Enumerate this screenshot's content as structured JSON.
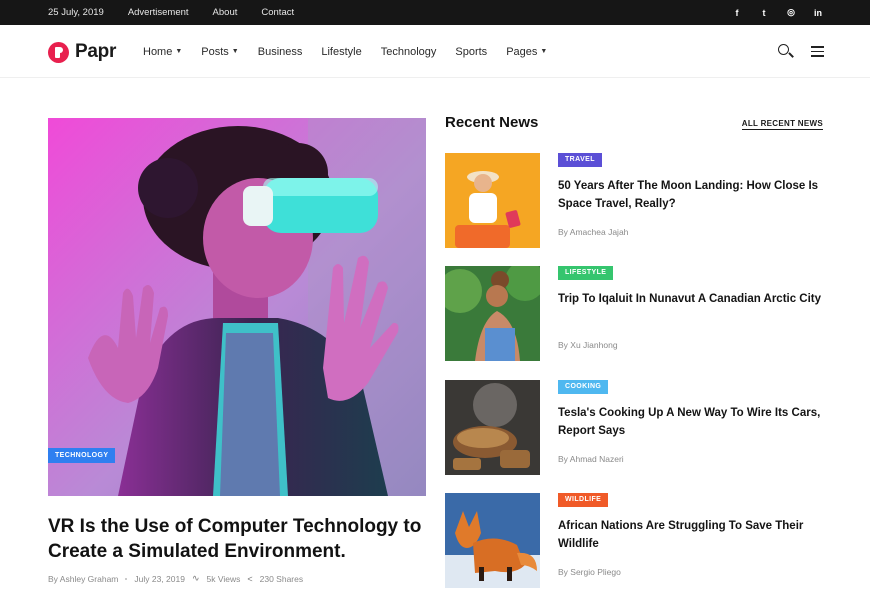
{
  "topbar": {
    "date": "25 July, 2019",
    "links": [
      "Advertisement",
      "About",
      "Contact"
    ],
    "social": [
      {
        "icon": "facebook-icon",
        "glyph": "f"
      },
      {
        "icon": "twitter-icon",
        "glyph": "t"
      },
      {
        "icon": "instagram-icon",
        "glyph": "◎"
      },
      {
        "icon": "linkedin-icon",
        "glyph": "in"
      }
    ]
  },
  "header": {
    "logo": "Papr",
    "brand_color": "#e8204e",
    "nav": [
      {
        "label": "Home",
        "dropdown": true
      },
      {
        "label": "Posts",
        "dropdown": true
      },
      {
        "label": "Business",
        "dropdown": false
      },
      {
        "label": "Lifestyle",
        "dropdown": false
      },
      {
        "label": "Technology",
        "dropdown": false
      },
      {
        "label": "Sports",
        "dropdown": false
      },
      {
        "label": "Pages",
        "dropdown": true
      }
    ]
  },
  "hero": {
    "category": "TECHNOLOGY",
    "category_color": "#2f7ff0",
    "title": "VR Is the Use of Computer Technology to Create a Simulated Environment.",
    "author": "By Ashley Graham",
    "date": "July 23, 2019",
    "views": "5k Views",
    "shares": "230 Shares"
  },
  "recent": {
    "heading": "Recent News",
    "all_link": "ALL RECENT NEWS",
    "items": [
      {
        "category": "TRAVEL",
        "color": "#5b4fd6",
        "title": "50 Years After The Moon Landing: How Close Is Space Travel, Really?",
        "author": "By Amachea Jajah"
      },
      {
        "category": "LIFESTYLE",
        "color": "#35c56e",
        "title": "Trip To Iqaluit In Nunavut A Canadian Arctic City",
        "author": "By Xu Jianhong"
      },
      {
        "category": "COOKING",
        "color": "#4fb8f0",
        "title": "Tesla's Cooking Up A New Way To Wire Its Cars, Report Says",
        "author": "By Ahmad Nazeri"
      },
      {
        "category": "WILDLIFE",
        "color": "#f05a28",
        "title": "African Nations Are Struggling To Save Their Wildlife",
        "author": "By Sergio Pliego"
      }
    ]
  }
}
